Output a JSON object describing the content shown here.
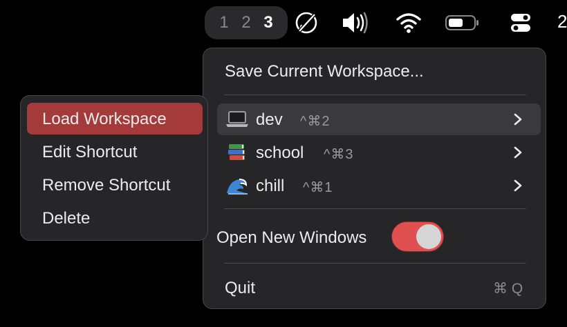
{
  "menubar": {
    "spaces": [
      {
        "label": "1",
        "active": false
      },
      {
        "label": "2",
        "active": false
      },
      {
        "label": "3",
        "active": true
      }
    ],
    "clipped_text": "2",
    "icons": [
      "rocket-slash-icon",
      "volume-icon",
      "wifi-icon",
      "battery-icon",
      "control-center-icon"
    ]
  },
  "main_menu": {
    "save_label": "Save Current Workspace...",
    "workspaces": [
      {
        "emoji": "laptop-icon",
        "name": "dev",
        "shortcut": "^⌘2"
      },
      {
        "emoji": "books-icon",
        "name": "school",
        "shortcut": "^⌘3"
      },
      {
        "emoji": "wave-icon",
        "name": "chill",
        "shortcut": "^⌘1"
      }
    ],
    "open_new_windows_label": "Open New Windows",
    "open_new_windows_on": true,
    "quit_label": "Quit",
    "quit_shortcut": "⌘ Q"
  },
  "context_menu": {
    "items": [
      {
        "label": "Load Workspace",
        "selected": true
      },
      {
        "label": "Edit Shortcut",
        "selected": false
      },
      {
        "label": "Remove Shortcut",
        "selected": false
      },
      {
        "label": "Delete",
        "selected": false
      }
    ]
  },
  "colors": {
    "selection": "#a43a3a",
    "toggle_on": "#e05050",
    "menu_bg": "#262628",
    "hover_bg": "#3a3a3c"
  }
}
